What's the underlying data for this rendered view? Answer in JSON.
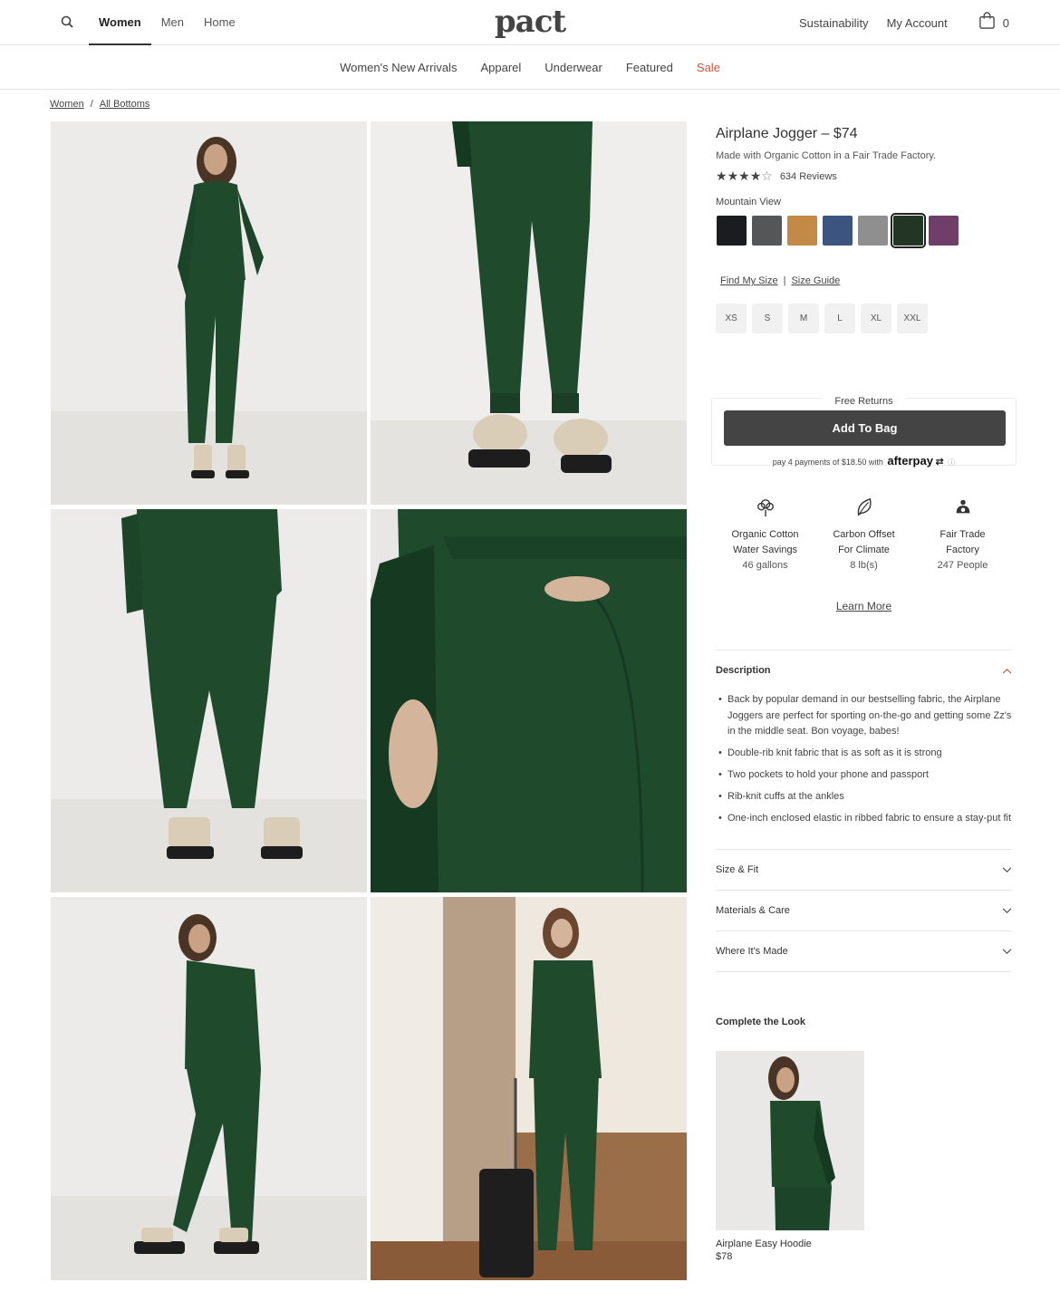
{
  "header": {
    "nav": [
      "Women",
      "Men",
      "Home"
    ],
    "active_nav": "Women",
    "logo": "pact",
    "right_links": [
      "Sustainability",
      "My Account"
    ],
    "cart_count": "0"
  },
  "subnav": {
    "items": [
      "Women's New Arrivals",
      "Apparel",
      "Underwear",
      "Featured"
    ],
    "sale": "Sale",
    "sale_color": "#c8573a"
  },
  "breadcrumb": {
    "items": [
      "Women",
      "All Bottoms"
    ],
    "separator": "/"
  },
  "product": {
    "title": "Airplane Jogger – $74",
    "subtitle": "Made with Organic Cotton in a Fair Trade Factory.",
    "rating": 4,
    "rating_max": 5,
    "reviews": "634 Reviews",
    "color_name": "Mountain View",
    "swatches": [
      "#1b1c20",
      "#555657",
      "#c28a46",
      "#3c5580",
      "#8f8f8f",
      "#233524",
      "#6f3f6a"
    ],
    "selected_swatch": 5,
    "find_size": "Find My Size",
    "size_guide": "Size Guide",
    "size_separator": "|",
    "sizes": [
      "XS",
      "S",
      "M",
      "L",
      "XL",
      "XXL"
    ],
    "free_returns": "Free Returns",
    "add_to_bag": "Add To Bag",
    "afterpay_text": "pay 4 payments of $18.50 with",
    "afterpay_logo": "afterpay",
    "afterpay_info": "ⓘ"
  },
  "impact": [
    {
      "icon": "cotton-icon",
      "line1": "Organic Cotton",
      "line2": "Water Savings",
      "value": "46 gallons"
    },
    {
      "icon": "leaf-icon",
      "line1": "Carbon Offset",
      "line2": "For Climate",
      "value": "8 lb(s)"
    },
    {
      "icon": "people-icon",
      "line1": "Fair Trade",
      "line2": "Factory",
      "value": "247 People"
    }
  ],
  "learn_more": "Learn More",
  "description": {
    "title": "Description",
    "bullets": [
      "Back by popular demand in our bestselling fabric, the Airplane Joggers are perfect for sporting on-the-go and getting some Zz's in the middle seat. Bon voyage, babes!",
      "Double-rib knit fabric that is as soft as it is strong",
      "Two pockets to hold your phone and passport",
      "Rib-knit cuffs at the ankles",
      "One-inch enclosed elastic in ribbed fabric to ensure a stay-put fit"
    ]
  },
  "accordions": [
    "Size & Fit",
    "Materials & Care",
    "Where It's Made"
  ],
  "complete_look": {
    "heading": "Complete the Look",
    "name": "Airplane Easy Hoodie",
    "price": "$78"
  },
  "colors": {
    "garment": "#1f4a2c",
    "garment_dark": "#163a21",
    "accent_chevron": "#c8573a"
  }
}
